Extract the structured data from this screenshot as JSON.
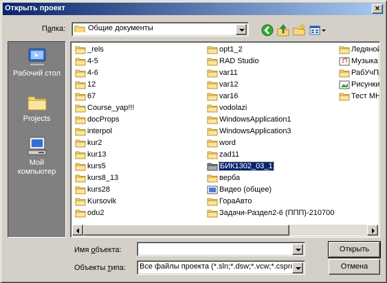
{
  "window": {
    "title": "Открыть проект",
    "close_glyph": "×"
  },
  "toolbar": {
    "folder_label_pre": "П",
    "folder_label_ul": "а",
    "folder_label_post": "пка:",
    "folder_value": "Общие документы",
    "tools": [
      "back-icon",
      "up-folder-icon",
      "new-folder-icon",
      "views-menu-icon"
    ]
  },
  "places": [
    {
      "label": "Рабочий стол",
      "icon": "desktop-icon"
    },
    {
      "label": "Projects",
      "icon": "folder-icon"
    },
    {
      "label": "Мой компьютер",
      "icon": "my-computer-icon"
    }
  ],
  "files": {
    "col1": [
      "_rels",
      "4-5",
      "4-6",
      "12",
      "67",
      "Course_yap!!!",
      "docProps",
      "interpol",
      "kur2",
      "kur13",
      "kurs5",
      "kurs8_13",
      "kurs28",
      "Kursovik",
      "odu2"
    ],
    "col2": [
      "opt1_2",
      "RAD Studio",
      "var11",
      "var12",
      "var16",
      "vodolazi",
      "WindowsApplication1",
      "WindowsApplication3",
      "word",
      "zad11",
      "БИК1302_03_1",
      "верба",
      "Видео (общее)",
      "ГораАвто",
      "Задачи-Раздел2-6 (ППП)-210700"
    ],
    "col3": [
      "Ледяной",
      "Музыка",
      "РабУчПр",
      "Рисунки",
      "Тест МН"
    ],
    "selected": "БИК1302_03_1"
  },
  "fields": {
    "name_label_pre": "Имя ",
    "name_label_ul": "о",
    "name_label_post": "бъекта:",
    "name_value": "",
    "type_label_pre": "Объекты ",
    "type_label_ul": "т",
    "type_label_post": "ипа:",
    "type_value": "Все файлы проекта (*.sln;*.dsw;*.vcw;*.csproj"
  },
  "buttons": {
    "open": "Открыть",
    "cancel": "Отмена"
  },
  "colors": {
    "title_start": "#0a246a",
    "title_end": "#a6caf0",
    "face": "#d4d0c8",
    "selection": "#0a246a"
  }
}
